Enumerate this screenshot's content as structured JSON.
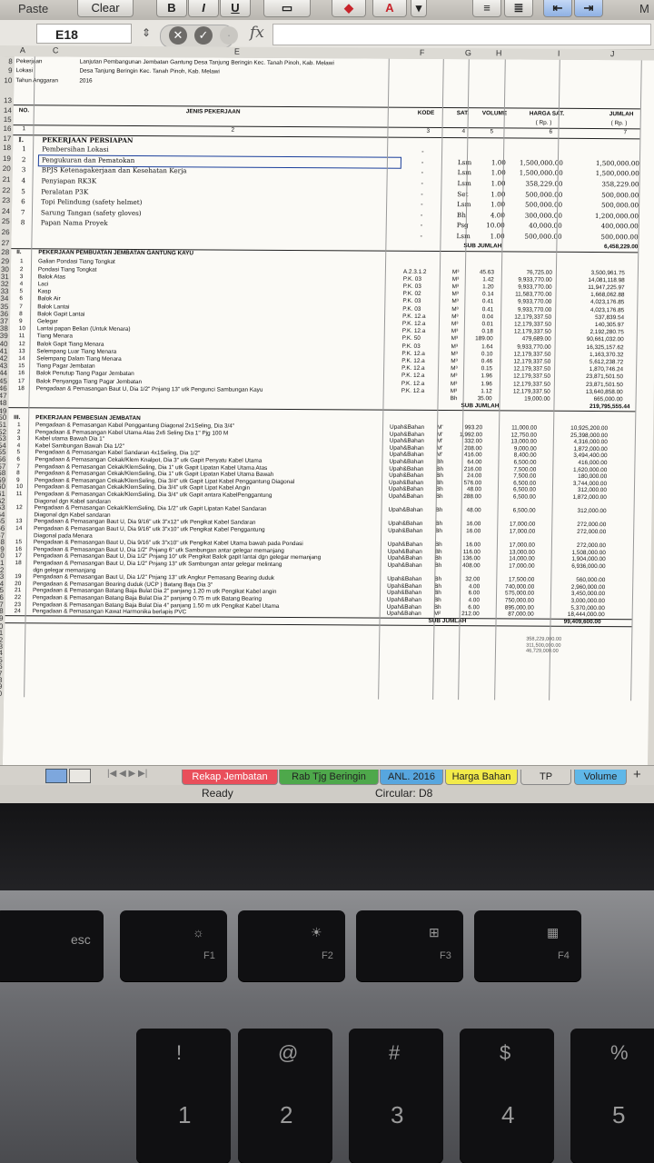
{
  "toolbar": {
    "paste": "Paste",
    "clear": "Clear",
    "bold": "B",
    "italic": "I",
    "underline": "U",
    "cut_tail": "M"
  },
  "formula_bar": {
    "cell_ref": "E18",
    "fx": "fx"
  },
  "columns": [
    "A",
    "C",
    "",
    "E",
    "F",
    "G",
    "H",
    "I",
    "J"
  ],
  "header_info": {
    "pekerjaan_label": "Pekerjaan",
    "pekerjaan_value": "Lanjutan Pembangunan Jembatan Gantung Desa Tanjung Beringin Kec. Tanah Pinoh, Kab. Melawi",
    "lokasi_label": "Lokasi",
    "lokasi_value": "Desa Tanjung Beringin Kec. Tanah Pinoh, Kab. Melawi",
    "tahun_label": "Tahun Anggaran",
    "tahun_value": "2016"
  },
  "table_header": {
    "no": "NO.",
    "jenis": "JENIS PEKERJAAN",
    "kode": "KODE",
    "sat": "SAT.",
    "volume": "VOLUME",
    "harga": "HARGA SAT.",
    "harga_unit": "( Rp. )",
    "jumlah": "JUMLAH",
    "jumlah_unit": "( Rp. )",
    "idx": [
      "1",
      "2",
      "3",
      "4",
      "5",
      "6",
      "7"
    ]
  },
  "section1": {
    "num": "I.",
    "title": "PEKERJAAN PERSIAPAN",
    "rows": [
      {
        "n": "1",
        "name": "Pembersihan Lokasi",
        "sat": "",
        "vol": "",
        "harga": "",
        "jumlah": ""
      },
      {
        "n": "2",
        "name": "Pengukuran dan Pematokan",
        "sat": "Lsm",
        "vol": "1.00",
        "harga": "1,500,000.00",
        "jumlah": "1,500,000.00"
      },
      {
        "n": "3",
        "name": "BPJS Ketenagakerjaan dan Kesehatan Kerja",
        "sat": "Lsm",
        "vol": "1.00",
        "harga": "1,500,000.00",
        "jumlah": "1,500,000.00"
      },
      {
        "n": "4",
        "name": "Penyiapan RK3K",
        "sat": "Lsm",
        "vol": "1.00",
        "harga": "358,229.00",
        "jumlah": "358,229.00"
      },
      {
        "n": "5",
        "name": "Peralatan P3K",
        "sat": "Set",
        "vol": "1.00",
        "harga": "500,000.00",
        "jumlah": "500,000.00"
      },
      {
        "n": "6",
        "name": "Topi Pelindung (safety helmet)",
        "sat": "Lsm",
        "vol": "1.00",
        "harga": "500,000.00",
        "jumlah": "500,000.00"
      },
      {
        "n": "7",
        "name": "Sarung Tangan (safety gloves)",
        "sat": "Bh",
        "vol": "4.00",
        "harga": "300,000.00",
        "jumlah": "1,200,000.00"
      },
      {
        "n": "8",
        "name": "Papan Nama Proyek",
        "sat": "Psg",
        "vol": "10.00",
        "harga": "40,000.00",
        "jumlah": "400,000.00"
      },
      {
        "n": "",
        "name": "",
        "sat": "Lsm",
        "vol": "1.00",
        "harga": "500,000.00",
        "jumlah": "500,000.00"
      }
    ],
    "subtotal_label": "SUB JUMLAH",
    "subtotal": "6,458,229.00"
  },
  "section2": {
    "num": "II.",
    "title": "PEKERJAAN PEMBUATAN JEMBATAN GANTUNG KAYU",
    "rows": [
      {
        "n": "1",
        "name": "Galian Pondasi Tiang Tongkat",
        "kode": "",
        "sat": "",
        "vol": "",
        "harga": "",
        "jumlah": ""
      },
      {
        "n": "2",
        "name": "Pondasi Tiang Tongkat",
        "kode": "A.2.3.1.2",
        "sat": "M³",
        "vol": "45.63",
        "harga": "76,725.00",
        "jumlah": "3,500,961.75"
      },
      {
        "n": "3",
        "name": "Balok Atas",
        "kode": "P.K. 03",
        "sat": "M³",
        "vol": "1.42",
        "harga": "9,933,770.00",
        "jumlah": "14,081,118.98"
      },
      {
        "n": "4",
        "name": "Laci",
        "kode": "P.K. 03",
        "sat": "M³",
        "vol": "1.20",
        "harga": "9,933,770.00",
        "jumlah": "11,947,225.97"
      },
      {
        "n": "5",
        "name": "Kasp",
        "kode": "P.K. 02",
        "sat": "M³",
        "vol": "0.14",
        "harga": "11,583,770.00",
        "jumlah": "1,668,062.88"
      },
      {
        "n": "6",
        "name": "Balok Air",
        "kode": "P.K. 03",
        "sat": "M³",
        "vol": "0.41",
        "harga": "9,933,770.00",
        "jumlah": "4,023,176.85"
      },
      {
        "n": "7",
        "name": "Balok Lantai",
        "kode": "P.K. 03",
        "sat": "M³",
        "vol": "0.41",
        "harga": "9,933,770.00",
        "jumlah": "4,023,176.85"
      },
      {
        "n": "8",
        "name": "Balok Gapit Lantai",
        "kode": "P.K. 12.a",
        "sat": "M³",
        "vol": "0.04",
        "harga": "12,179,337.50",
        "jumlah": "537,839.54"
      },
      {
        "n": "9",
        "name": "Gelegar",
        "kode": "P.K. 12.a",
        "sat": "M³",
        "vol": "0.01",
        "harga": "12,179,337.50",
        "jumlah": "140,305.97"
      },
      {
        "n": "10",
        "name": "Lantai papan Belian (Untuk Menara)",
        "kode": "P.K. 12.a",
        "sat": "M³",
        "vol": "0.18",
        "harga": "12,179,337.50",
        "jumlah": "2,192,280.75"
      },
      {
        "n": "11",
        "name": "Tiang Menara",
        "kode": "P.K. 50",
        "sat": "M³",
        "vol": "189.00",
        "harga": "479,689.00",
        "jumlah": "90,661,032.00"
      },
      {
        "n": "12",
        "name": "Balok Gapit Tiang Menara",
        "kode": "P.K. 03",
        "sat": "M³",
        "vol": "1.64",
        "harga": "9,933,770.00",
        "jumlah": "16,325,157.62"
      },
      {
        "n": "13",
        "name": "Selempang Luar Tiang Menara",
        "kode": "P.K. 12.a",
        "sat": "M³",
        "vol": "0.10",
        "harga": "12,179,337.50",
        "jumlah": "1,163,370.32"
      },
      {
        "n": "14",
        "name": "Selempang Dalam Tiang Menara",
        "kode": "P.K. 12.a",
        "sat": "M³",
        "vol": "0.46",
        "harga": "12,179,337.50",
        "jumlah": "5,612,238.72"
      },
      {
        "n": "15",
        "name": "Tiang Pagar Jembatan",
        "kode": "P.K. 12.a",
        "sat": "M³",
        "vol": "0.15",
        "harga": "12,179,337.50",
        "jumlah": "1,870,746.24"
      },
      {
        "n": "16",
        "name": "Balok Penutup Tiang Pagar Jembatan",
        "kode": "P.K. 12.a",
        "sat": "M³",
        "vol": "1.96",
        "harga": "12,179,337.50",
        "jumlah": "23,871,501.50"
      },
      {
        "n": "17",
        "name": "Balok Penyangga Tiang Pagar Jembatan",
        "kode": "P.K. 12.a",
        "sat": "M³",
        "vol": "1.96",
        "harga": "12,179,337.50",
        "jumlah": "23,871,501.50"
      },
      {
        "n": "18",
        "name": "Pengadaan & Pemasangan Baut U, Dia 1/2\" Pnjang 13\" utk Pengunci Sambungan Kayu",
        "kode": "P.K. 12.a",
        "sat": "M³",
        "vol": "1.12",
        "harga": "12,179,337.50",
        "jumlah": "13,640,858.00"
      },
      {
        "n": "",
        "name": "",
        "kode": "",
        "sat": "Bh",
        "vol": "35.00",
        "harga": "19,000.00",
        "jumlah": "665,000.00"
      }
    ],
    "subtotal_label": "SUB JUMLAH",
    "subtotal": "219,795,555.44"
  },
  "section3": {
    "num": "III.",
    "title": "PEKERJAAN PEMBESIAN JEMBATAN",
    "rows": [
      {
        "n": "1",
        "name": "Pengadaan & Pemasangan Kabel Penggantung Diagonal 2x1Seling, Dia 3/4\"",
        "kode": "Upah&Bahan",
        "sat": "M'",
        "vol": "993.20",
        "harga": "11,000.00",
        "jumlah": "10,925,200.00"
      },
      {
        "n": "2",
        "name": "Pengadaan & Pemasangan Kabel Utama Atas 2x6 Seling Dia 1\" Pjg 100 M",
        "kode": "Upah&Bahan",
        "sat": "M'",
        "vol": "1,992.00",
        "harga": "12,750.00",
        "jumlah": "25,398,000.00"
      },
      {
        "n": "3",
        "name": "Kabel utama Bawah Dia 1\"",
        "kode": "Upah&Bahan",
        "sat": "M'",
        "vol": "332.00",
        "harga": "13,000.00",
        "jumlah": "4,316,000.00"
      },
      {
        "n": "4",
        "name": "Kabel Sambungan Bawah Dia 1/2\"",
        "kode": "Upah&Bahan",
        "sat": "M'",
        "vol": "208.00",
        "harga": "9,000.00",
        "jumlah": "1,872,000.00"
      },
      {
        "n": "5",
        "name": "Pengadaan & Pemasangan Kabel Sandaran 4x1Seling, Dia 1/2\"",
        "kode": "Upah&Bahan",
        "sat": "M'",
        "vol": "416.00",
        "harga": "8,400.00",
        "jumlah": "3,494,400.00"
      },
      {
        "n": "6",
        "name": "Pengadaan & Pemasangan Cekak/Klem Knalpot, Dia 3\" utk Gapit Penyatu Kabel Utama",
        "kode": "Upah&Bahan",
        "sat": "Bh",
        "vol": "64.00",
        "harga": "6,500.00",
        "jumlah": "416,000.00"
      },
      {
        "n": "7",
        "name": "Pengadaan & Pemasangan Cekak/KlemSeling, Dia 1\" utk Gapit Lipatan Kabel Utama Atas",
        "kode": "Upah&Bahan",
        "sat": "Bh",
        "vol": "216.00",
        "harga": "7,500.00",
        "jumlah": "1,620,000.00"
      },
      {
        "n": "8",
        "name": "Pengadaan & Pemasangan Cekak/KlemSeling, Dia 1\" utk Gapit Lipatan Kabel Utama Bawah",
        "kode": "Upah&Bahan",
        "sat": "Bh",
        "vol": "24.00",
        "harga": "7,500.00",
        "jumlah": "180,000.00"
      },
      {
        "n": "9",
        "name": "Pengadaan & Pemasangan Cekak/KlemSeling, Dia 3/4\" utk Gapit Lipat Kabel Penggantung Diagonal",
        "kode": "Upah&Bahan",
        "sat": "Bh",
        "vol": "576.00",
        "harga": "6,500.00",
        "jumlah": "3,744,000.00"
      },
      {
        "n": "10",
        "name": "Pengadaan & Pemasangan Cekak/KlemSeling, Dia 3/4\" utk Gapit Lipat Kabel Angin",
        "kode": "Upah&Bahan",
        "sat": "Bh",
        "vol": "48.00",
        "harga": "6,500.00",
        "jumlah": "312,000.00"
      },
      {
        "n": "11",
        "name": "Pengadaan & Pemasangan Cekak/KlemSeling, Dia 3/4\" utk Gapit antara KabelPenggantung",
        "kode": "Upah&Bahan",
        "sat": "Bh",
        "vol": "288.00",
        "harga": "6,500.00",
        "jumlah": "1,872,000.00"
      },
      {
        "n": "",
        "name": "Diagonal dgn Kabel sandaran",
        "kode": "",
        "sat": "",
        "vol": "",
        "harga": "",
        "jumlah": ""
      },
      {
        "n": "12",
        "name": "Pengadaan & Pemasangan Cekak/KlemSeling, Dia 1/2\" utk Gapit Lipatan Kabel Sandaran",
        "kode": "Upah&Bahan",
        "sat": "Bh",
        "vol": "48.00",
        "harga": "6,500.00",
        "jumlah": "312,000.00"
      },
      {
        "n": "",
        "name": "Diagonal dgn Kabel sandaran",
        "kode": "",
        "sat": "",
        "vol": "",
        "harga": "",
        "jumlah": ""
      },
      {
        "n": "13",
        "name": "Pengadaan & Pemasangan Baut U, Dia 9/16\" utk 3\"x12\" utk Pengikat Kabel Sandaran",
        "kode": "Upah&Bahan",
        "sat": "Bh",
        "vol": "16.00",
        "harga": "17,000.00",
        "jumlah": "272,000.00"
      },
      {
        "n": "14",
        "name": "Pengadaan & Pemasangan Baut U, Dia 9/16\" utk 3\"x10\" utk Pengikat Kabel Penggantung",
        "kode": "Upah&Bahan",
        "sat": "Bh",
        "vol": "16.00",
        "harga": "17,000.00",
        "jumlah": "272,000.00"
      },
      {
        "n": "",
        "name": "Diagonal pada Menara",
        "kode": "",
        "sat": "",
        "vol": "",
        "harga": "",
        "jumlah": ""
      },
      {
        "n": "15",
        "name": "Pengadaan & Pemasangan Baut U, Dia 9/16\" utk 3\"x10\" utk Pengikat Kabel Utama bawah pada Pondasi",
        "kode": "Upah&Bahan",
        "sat": "Bh",
        "vol": "16.00",
        "harga": "17,000.00",
        "jumlah": "272,000.00"
      },
      {
        "n": "16",
        "name": "Pengadaan & Pemasangan Baut U, Dia 1/2\" Pnjang 6\" utk Sambungan antar gelegar memanjang",
        "kode": "Upah&Bahan",
        "sat": "Bh",
        "vol": "116.00",
        "harga": "13,000.00",
        "jumlah": "1,508,000.00"
      },
      {
        "n": "17",
        "name": "Pengadaan & Pemasangan Baut U, Dia 1/2\" Pnjang 10\" utk Pengikat Balok gapit lantai dgn gelegar memanjang",
        "kode": "Upah&Bahan",
        "sat": "Bh",
        "vol": "136.00",
        "harga": "14,000.00",
        "jumlah": "1,904,000.00"
      },
      {
        "n": "18",
        "name": "Pengadaan & Pemasangan Baut U, Dia 1/2\" Pnjang 13\" utk Sambungan antar gelegar melintang",
        "kode": "Upah&Bahan",
        "sat": "Bh",
        "vol": "408.00",
        "harga": "17,000.00",
        "jumlah": "6,936,000.00"
      },
      {
        "n": "",
        "name": "dgn gelegar memanjang",
        "kode": "",
        "sat": "",
        "vol": "",
        "harga": "",
        "jumlah": ""
      },
      {
        "n": "19",
        "name": "Pengadaan & Pemasangan Baut U, Dia 1/2\" Pnjang 13\" utk Angkur Pemasang Bearing duduk",
        "kode": "Upah&Bahan",
        "sat": "Bh",
        "vol": "32.00",
        "harga": "17,500.00",
        "jumlah": "560,000.00"
      },
      {
        "n": "20",
        "name": "Pengadaan & Pemasangan Bearing duduk (UCP ) Batang Baja Dia 3\"",
        "kode": "Upah&Bahan",
        "sat": "Bh",
        "vol": "4.00",
        "harga": "740,000.00",
        "jumlah": "2,960,000.00"
      },
      {
        "n": "21",
        "name": "Pengadaan & Pemasangan Batang Baja Bulat Dia 2\" panjang 1.20 m utk Pengikat Kabel angin",
        "kode": "Upah&Bahan",
        "sat": "Bh",
        "vol": "6.00",
        "harga": "575,000.00",
        "jumlah": "3,450,000.00"
      },
      {
        "n": "22",
        "name": "Pengadaan & Pemasangan Batang Baja Bulat Dia 2\" panjang 0.75 m utk Batang Bearing",
        "kode": "Upah&Bahan",
        "sat": "Bh",
        "vol": "4.00",
        "harga": "750,000.00",
        "jumlah": "3,000,000.00"
      },
      {
        "n": "23",
        "name": "Pengadaan & Pemasangan Batang Baja Bulat Dia 4\" panjang 1.50 m utk Pengikat Kabel Utama",
        "kode": "Upah&Bahan",
        "sat": "Bh",
        "vol": "6.00",
        "harga": "895,000.00",
        "jumlah": "5,370,000.00"
      },
      {
        "n": "24",
        "name": "Pengadaan & Pemasangan Kawat Harmonika berlapis PVC",
        "kode": "Upah&Bahan",
        "sat": "M²",
        "vol": "212.00",
        "harga": "87,000.00",
        "jumlah": "18,444,000.00"
      }
    ],
    "subtotal_label": "SUB JUMLAH",
    "subtotal": "99,409,600.00"
  },
  "stray_numbers": [
    "358,229,000.00",
    "311,500,000.00",
    "46,729,000.00"
  ],
  "sheet_tabs": [
    {
      "label": "Rekap Jembatan",
      "color": "#e94f5b"
    },
    {
      "label": "Rab Tjg Beringin",
      "color": "#4ea84b"
    },
    {
      "label": "ANL. 2016",
      "color": "#57a6df"
    },
    {
      "label": "Harga Bahan",
      "color": "#f2ea4a"
    },
    {
      "label": "TP",
      "color": "#d6d3cd"
    },
    {
      "label": "Volume",
      "color": "#5fb7e8"
    }
  ],
  "tab_nav": "|◀  ◀  ▶  ▶|",
  "status": {
    "ready": "Ready",
    "circular": "Circular: D8"
  },
  "keyboard": {
    "row1": [
      {
        "main": "esc",
        "sub": ""
      },
      {
        "main": "☼",
        "sub": "F1"
      },
      {
        "main": "☀",
        "sub": "F2"
      },
      {
        "main": "⊞",
        "sub": "F3"
      },
      {
        "main": "▦",
        "sub": "F4"
      }
    ],
    "row2": [
      {
        "top": "!",
        "main": "1"
      },
      {
        "top": "@",
        "main": "2"
      },
      {
        "top": "#",
        "main": "3"
      },
      {
        "top": "$",
        "main": "4"
      },
      {
        "top": "%",
        "main": "5"
      }
    ]
  }
}
